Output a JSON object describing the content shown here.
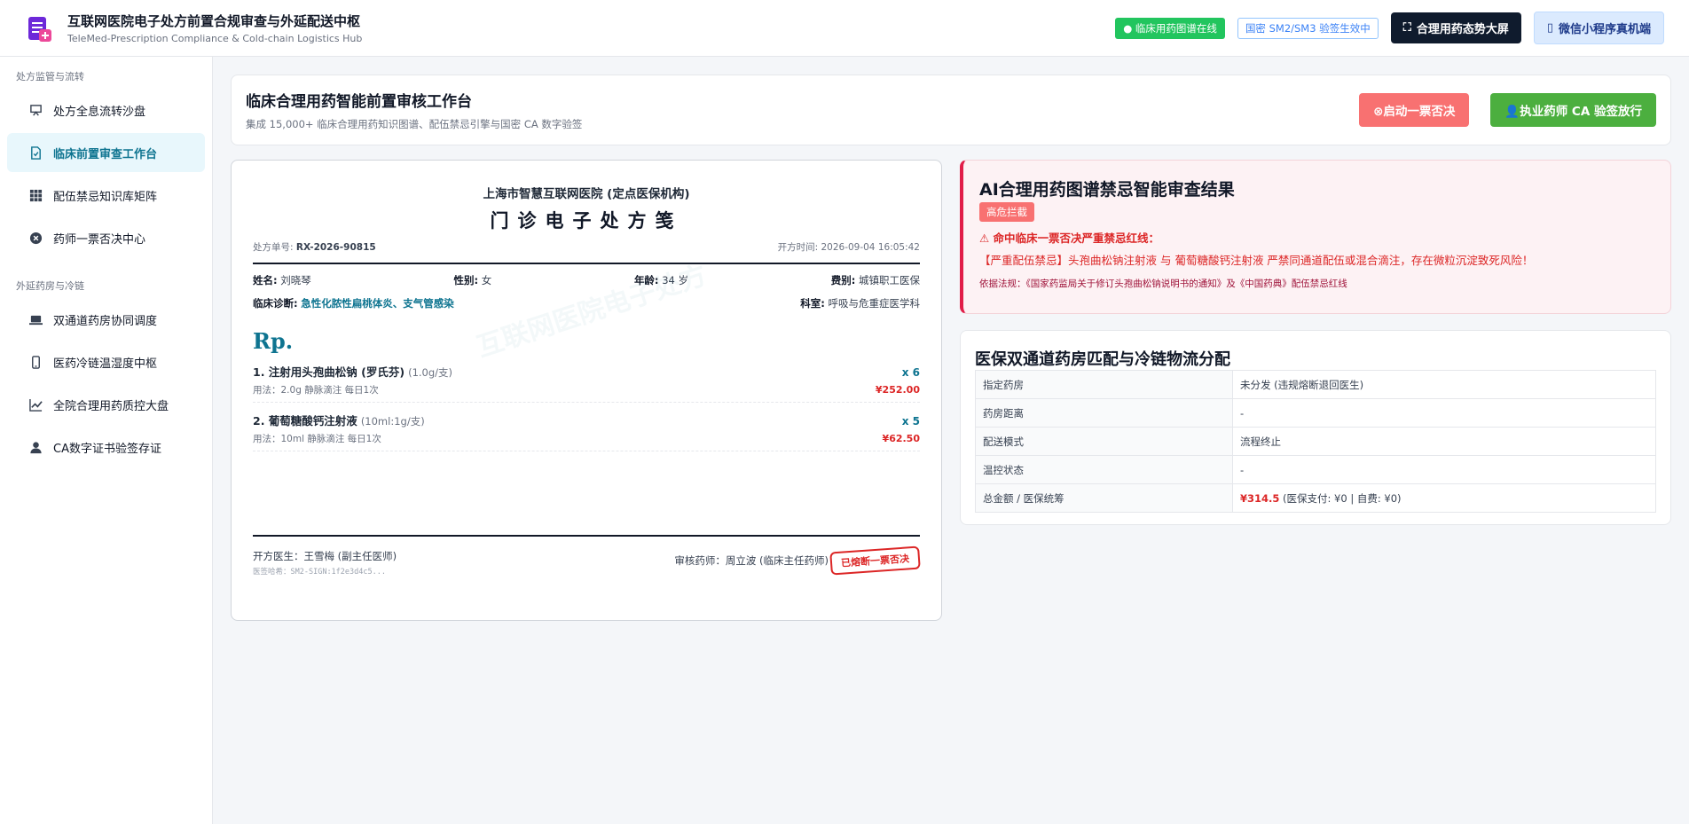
{
  "header": {
    "title": "互联网医院电子处方前置合规审查与外延配送中枢",
    "subtitle": "TeleMed-Prescription Compliance & Cold-chain Logistics Hub",
    "online_badge": "● 临床用药图谱在线",
    "sm_badge": "国密 SM2/SM3 验签生效中",
    "dashboard_button": "合理用药态势大屏",
    "miniapp_button": "微信小程序真机端"
  },
  "sidebar": {
    "group1": "处方监管与流转",
    "group2": "外延药房与冷链",
    "items": [
      {
        "label": "处方全息流转沙盘",
        "icon": "presentation-board-icon"
      },
      {
        "label": "临床前置审查工作台",
        "icon": "document-check-icon"
      },
      {
        "label": "配伍禁忌知识库矩阵",
        "icon": "grid-icon"
      },
      {
        "label": "药师一票否决中心",
        "icon": "x-circle-icon"
      },
      {
        "label": "双通道药房协同调度",
        "icon": "laptop-icon"
      },
      {
        "label": "医药冷链温湿度中枢",
        "icon": "mobile-icon"
      },
      {
        "label": "全院合理用药质控大盘",
        "icon": "chart-line-icon"
      },
      {
        "label": "CA数字证书验签存证",
        "icon": "user-icon"
      }
    ]
  },
  "workbench": {
    "title": "临床合理用药智能前置审核工作台",
    "subtitle": "集成 15,000+ 临床合理用药知识图谱、配伍禁忌引擎与国密 CA 数字验签",
    "reject_button": "⊗启动一票否决",
    "approve_button": "👤执业药师 CA 验签放行"
  },
  "prescription": {
    "watermark": "互联网医院电子处方",
    "hospital": "上海市智慧互联网医院 (定点医保机构)",
    "title": "门诊电子处方笺",
    "no_label": "处方单号:",
    "no": "RX-2026-90815",
    "time_label": "开方时间:",
    "time": "2026-09-04 16:05:42",
    "name_label": "姓名:",
    "name": "刘晓琴",
    "gender_label": "性别:",
    "gender": "女",
    "age_label": "年龄:",
    "age": "34 岁",
    "fee_label": "费别:",
    "fee": "城镇职工医保",
    "diag_label": "临床诊断:",
    "diag": "急性化脓性扁桃体炎、支气管感染",
    "dept_label": "科室:",
    "dept": "呼吸与危重症医学科",
    "rp": "Rp.",
    "drugs": [
      {
        "name": "1.  注射用头孢曲松钠 (罗氏芬)",
        "spec": "(1.0g/支)",
        "qty": "x 6",
        "usage": "用法：2.0g 静脉滴注 每日1次",
        "price": "¥252.00"
      },
      {
        "name": "2.  葡萄糖酸钙注射液",
        "spec": "(10ml:1g/支)",
        "qty": "x 5",
        "usage": "用法：10ml 静脉滴注 每日1次",
        "price": "¥62.50"
      }
    ],
    "doctor": "开方医生：王雪梅 (副主任医师)",
    "signature": "医签哈希：SM2-SIGN:1f2e3d4c5...",
    "pharmacist": "审核药师：周立波 (临床主任药师)",
    "stamp": "已熔断一票否决"
  },
  "ai_result": {
    "title": "AI合理用药图谱禁忌智能审查结果",
    "tag": "高危拦截",
    "hit": "⚠ 命中临床一票否决严重禁忌红线：",
    "detail": "【严重配伍禁忌】头孢曲松钠注射液 与 葡萄糖酸钙注射液 严禁同通道配伍或混合滴注，存在微粒沉淀致死风险！",
    "law": "依据法规：《国家药监局关于修订头孢曲松钠说明书的通知》及《中国药典》配伍禁忌红线"
  },
  "dispatch": {
    "title": "医保双通道药房匹配与冷链物流分配",
    "rows": [
      {
        "k": "指定药房",
        "v": "未分发 (违规熔断退回医生)"
      },
      {
        "k": "药房距离",
        "v": "-"
      },
      {
        "k": "配送模式",
        "v": "流程终止"
      },
      {
        "k": "温控状态",
        "v": "-"
      }
    ],
    "total_label": "总金额 / 医保统筹",
    "total_amount": "¥314.5",
    "total_note": " (医保支付: ¥0 | 自费: ¥0)"
  },
  "colors": {
    "accent": "#0e7490",
    "danger": "#dc2626",
    "success": "#4caf3f",
    "dark": "#0f1b2d"
  }
}
